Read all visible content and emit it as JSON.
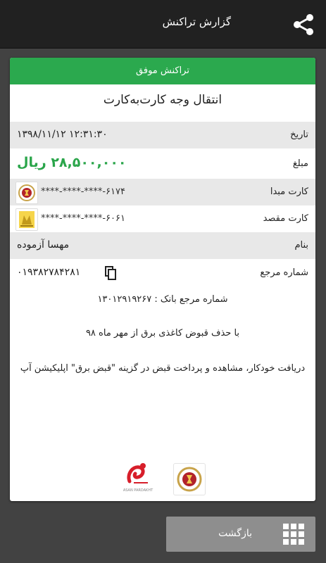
{
  "header": {
    "title": "گزارش تراکنش"
  },
  "card": {
    "status": "تراکنش موفق",
    "transaction_type": "انتقال وجه کارت‌به‌کارت",
    "date": {
      "label": "تاریخ",
      "value": "۱۳۹۸/۱۱/۱۲ ۱۲:۳۱:۳۰"
    },
    "amount": {
      "label": "مبلغ",
      "value": "۲۸,۵۰۰,۰۰۰ ریال"
    },
    "source_card": {
      "label": "کارت مبدا",
      "value": "****-****-****-۶۱۷۴"
    },
    "dest_card": {
      "label": "کارت مقصد",
      "value": "****-****-****-۶۰۶۱"
    },
    "name": {
      "label": "بنام",
      "value": "مهسا آزموده"
    },
    "reference": {
      "label": "شماره مرجع",
      "value": "۰۱۹۳۸۲۷۸۴۲۸۱"
    },
    "bank_reference": "شماره مرجع بانک : ۱۳۰۱۲۹۱۹۲۶۷",
    "note": "با حذف قبوض کاغذی برق از مهر ماه ۹۸",
    "promo": "دریافت خودکار، مشاهده و پرداخت قبض در گزینه \"قبض برق\" اپلیکیشن آپ",
    "asan_caption": "ASAN PARDAKHT"
  },
  "footer": {
    "back_label": "بازگشت"
  },
  "colors": {
    "success": "#2ba94e",
    "amount": "#2aa54a",
    "appbar": "#212121",
    "background": "#424242"
  },
  "icons": [
    "share-icon",
    "copy-icon",
    "grid-icon",
    "bank-melli-logo",
    "asan-pardakht-logo"
  ]
}
